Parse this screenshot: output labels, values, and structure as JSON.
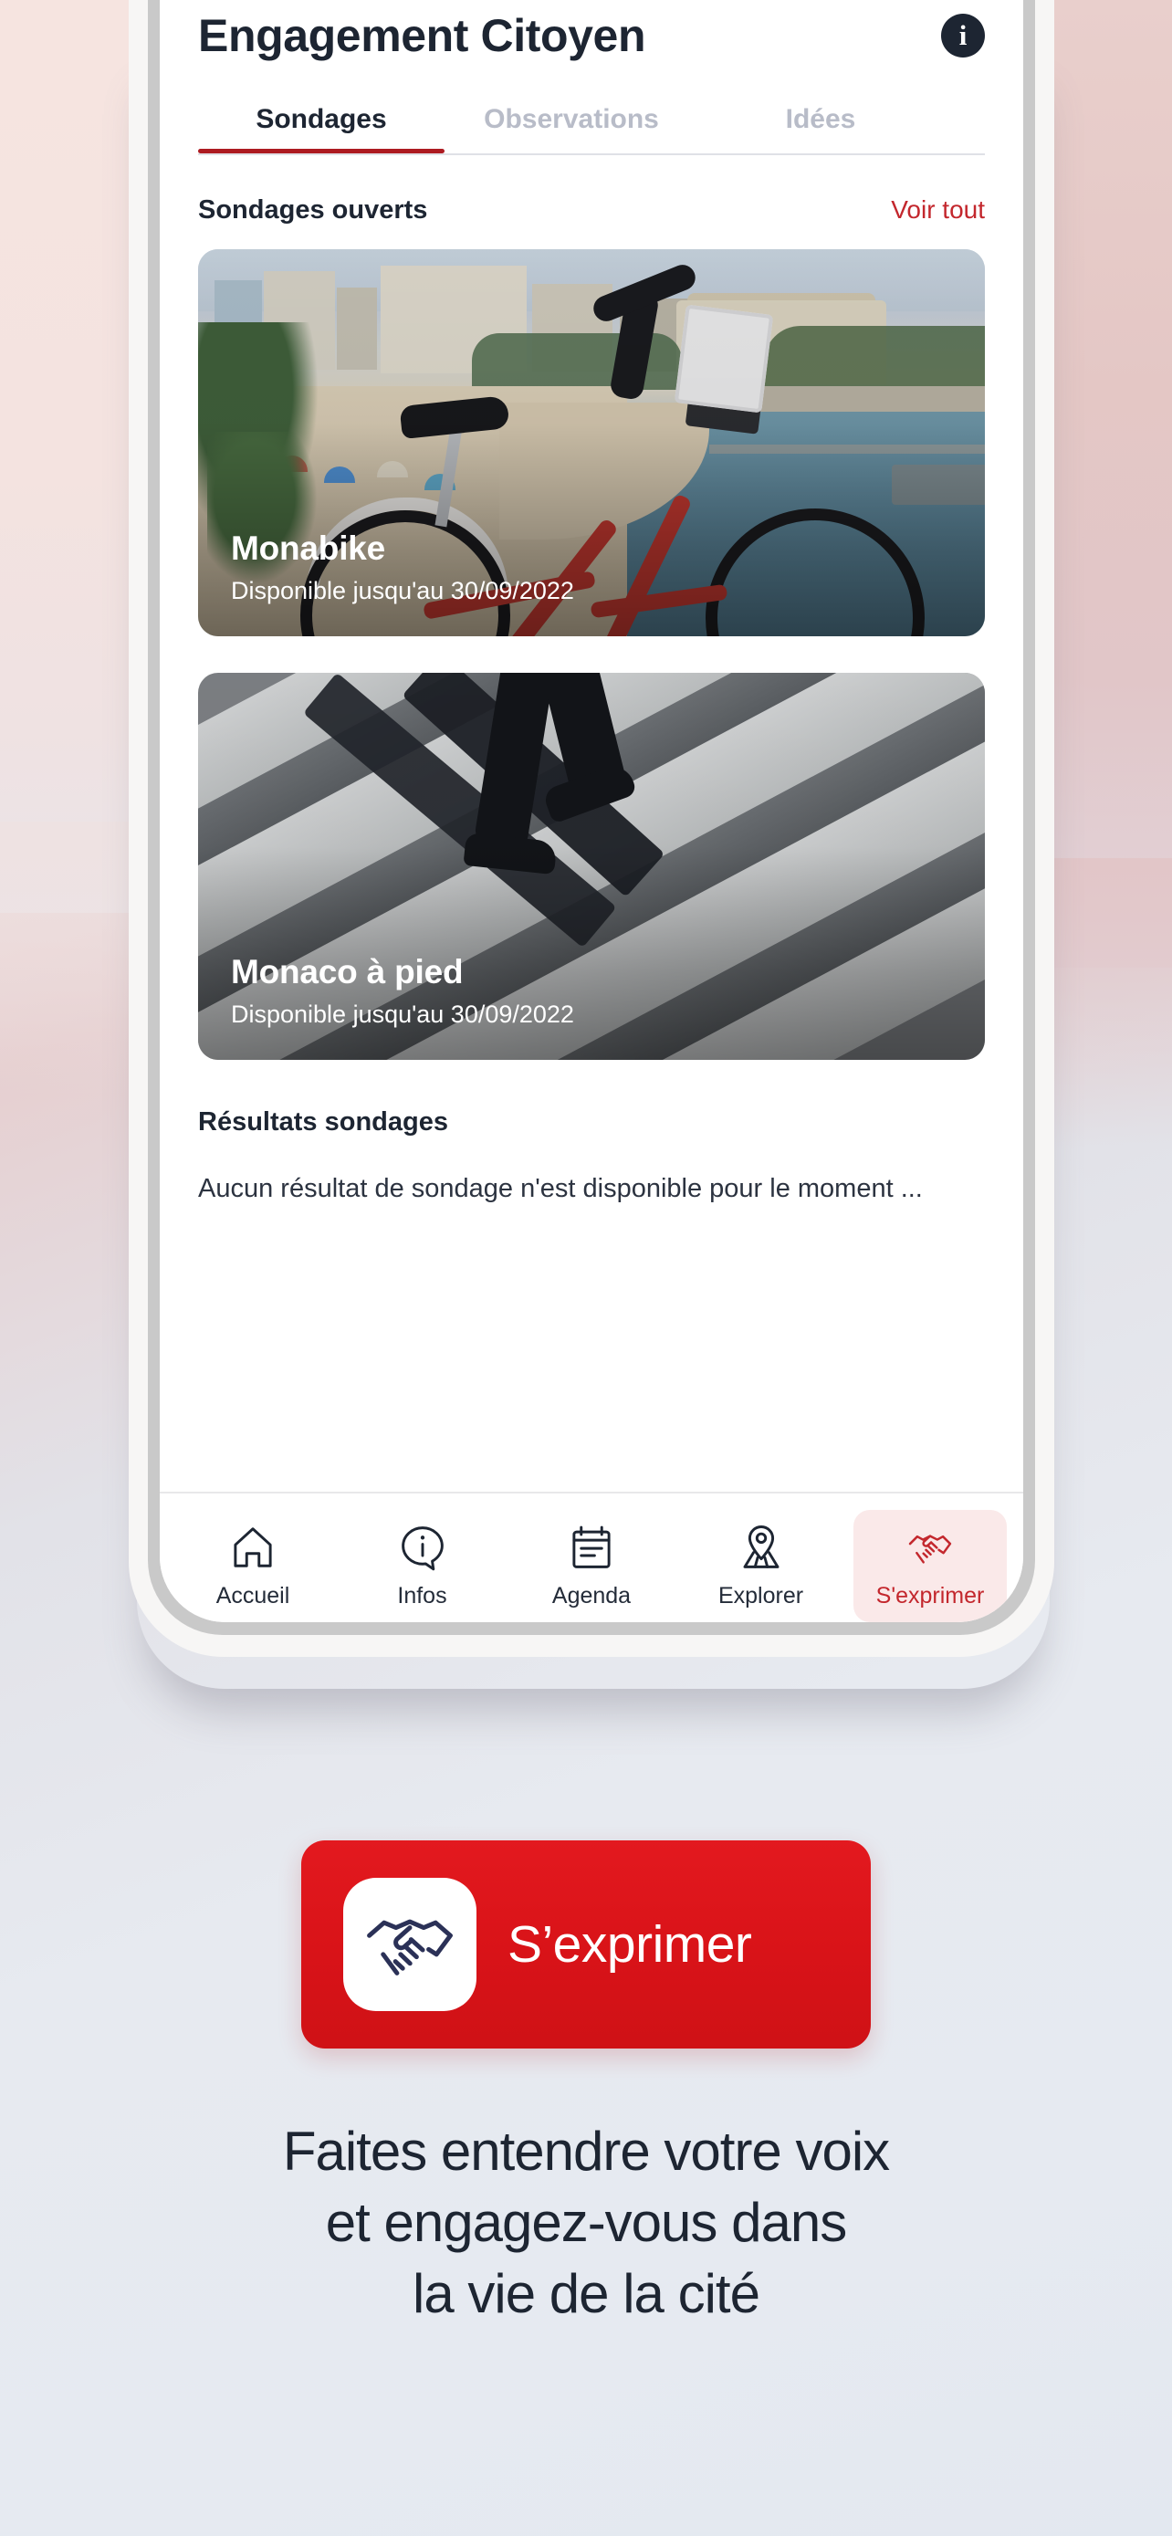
{
  "app": {
    "title": "Engagement Citoyen",
    "info_icon": "info-circle-icon"
  },
  "tabs": [
    {
      "label": "Sondages",
      "active": true
    },
    {
      "label": "Observations",
      "active": false
    },
    {
      "label": "Idées",
      "active": false
    }
  ],
  "open_polls": {
    "section_title": "Sondages ouverts",
    "see_all_label": "Voir tout",
    "cards": [
      {
        "title": "Monabike",
        "subtitle": "Disponible jusqu'au 30/09/2022",
        "image_description": "Vélo Monabike rouge devant la plage du Larvotto à Monaco"
      },
      {
        "title": "Monaco à pied",
        "subtitle": "Disponible jusqu'au 30/09/2022",
        "image_description": "Piéton traversant un passage clouté, photo en noir et blanc"
      }
    ]
  },
  "results": {
    "title": "Résultats sondages",
    "empty_message": "Aucun résultat de sondage n'est disponible pour le moment ..."
  },
  "bottom_nav": [
    {
      "label": "Accueil",
      "icon": "home-icon",
      "active": false
    },
    {
      "label": "Infos",
      "icon": "speech-bubble-info-icon",
      "active": false
    },
    {
      "label": "Agenda",
      "icon": "calendar-icon",
      "active": false
    },
    {
      "label": "Explorer",
      "icon": "map-pin-icon",
      "active": false
    },
    {
      "label": "S'exprimer",
      "icon": "handshake-icon",
      "active": true
    }
  ],
  "cta": {
    "label": "S’exprimer",
    "icon": "handshake-icon"
  },
  "tagline": {
    "line1": "Faites entendre votre voix",
    "line2": "et engagez-vous dans",
    "line3": "la vie de la cité"
  },
  "colors": {
    "brand_red": "#d91318",
    "accent_red": "#c3272d",
    "tab_underline": "#ad1b21",
    "text_dark": "#1d2532",
    "tab_inactive": "#b8bcc8",
    "nav_active_bg": "#fae9e9",
    "bg_top_left_pink": "#f5e3e0",
    "bg_right_pink": "#e3c4c2",
    "bg_bottom_blue_gray": "#e6eaf0"
  }
}
